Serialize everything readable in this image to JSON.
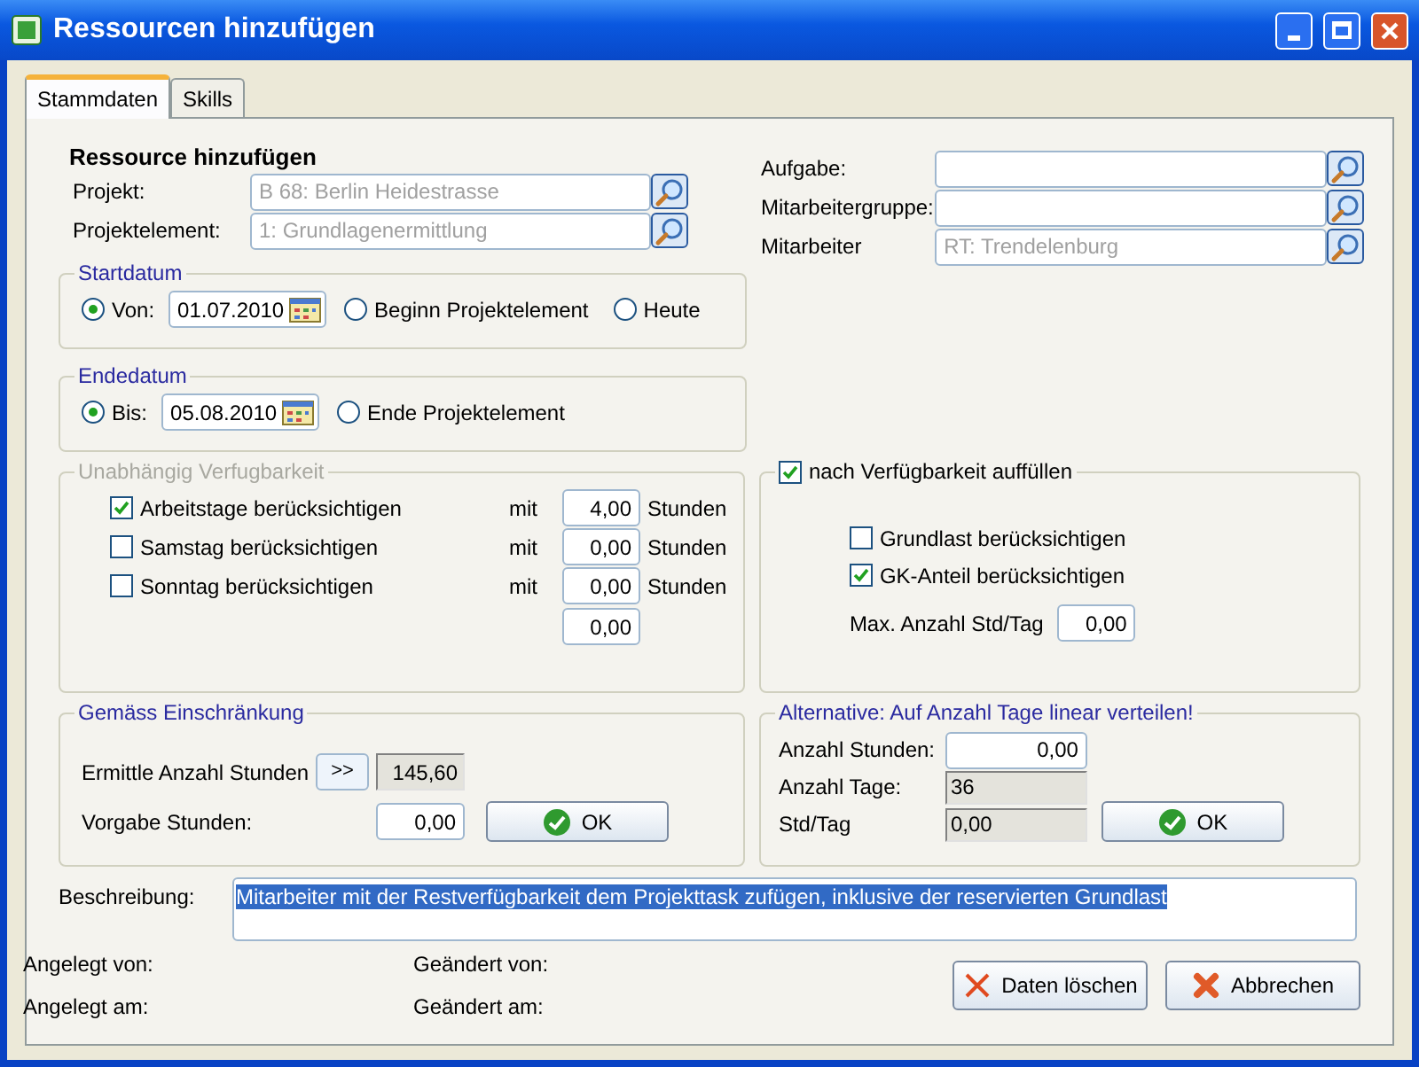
{
  "window": {
    "title": "Ressourcen hinzufügen"
  },
  "tabs": [
    {
      "label": "Stammdaten",
      "selected": true
    },
    {
      "label": "Skills",
      "selected": false
    }
  ],
  "heading": "Ressource hinzufügen",
  "left_fields": [
    {
      "label": "Projekt:",
      "value": "B 68: Berlin Heidestrasse",
      "disabled": true
    },
    {
      "label": "Projektelement:",
      "value": "1: Grundlagenermittlung",
      "disabled": true
    }
  ],
  "right_fields": [
    {
      "label": "Aufgabe:"
    },
    {
      "label": "Mitarbeitergruppe:"
    },
    {
      "label": "Mitarbeiter",
      "value": "RT: Trendelenburg",
      "disabled": true
    }
  ],
  "startdatum": {
    "title": "Startdatum",
    "options": [
      {
        "label": "Von:",
        "selected": true,
        "date": "01.07.2010"
      },
      {
        "label": "Beginn Projektelement",
        "selected": false
      },
      {
        "label": "Heute",
        "selected": false
      }
    ]
  },
  "endedatum": {
    "title": "Endedatum",
    "options": [
      {
        "label": "Bis:",
        "selected": true,
        "date": "05.08.2010"
      },
      {
        "label": "Ende Projektelement",
        "selected": false
      }
    ]
  },
  "unabhaengig": {
    "title": "Unabhängig Verfugbarkeit",
    "disabled": true,
    "rows": [
      {
        "label": "Arbeitstage berücksichtigen",
        "checked": true,
        "mit": "mit",
        "value": "4,00",
        "unit": "Stunden"
      },
      {
        "label": "Samstag berücksichtigen",
        "checked": false,
        "mit": "mit",
        "value": "0,00",
        "unit": "Stunden"
      },
      {
        "label": "Sonntag berücksichtigen",
        "checked": false,
        "mit": "mit",
        "value": "0,00",
        "unit": "Stunden"
      }
    ],
    "total": "0,00"
  },
  "auffuellen": {
    "label": "nach Verfügbarkeit auffüllen",
    "checked": true,
    "options": [
      {
        "label": "Grundlast berücksichtigen",
        "checked": false
      },
      {
        "label": "GK-Anteil berücksichtigen",
        "checked": true
      }
    ],
    "max_label": "Max. Anzahl Std/Tag",
    "max_value": "0,00"
  },
  "einschraenkung": {
    "title": "Gemäss Einschränkung",
    "ermittle_label": "Ermittle Anzahl Stunden",
    "ermittle_button": ">>",
    "ermittle_value": "145,60",
    "vorgabe_label": "Vorgabe Stunden:",
    "vorgabe_value": "0,00",
    "ok": "OK"
  },
  "alternative": {
    "title": "Alternative: Auf Anzahl Tage linear verteilen!",
    "rows": [
      {
        "label": "Anzahl Stunden:",
        "value": "0,00",
        "kind": "input"
      },
      {
        "label": "Anzahl Tage:",
        "value": "36",
        "kind": "readonly"
      },
      {
        "label": "Std/Tag",
        "value": "0,00",
        "kind": "readonly"
      }
    ],
    "ok": "OK"
  },
  "beschreibung": {
    "label": "Beschreibung:",
    "value": "Mitarbeiter mit der Restverfügbarkeit dem Projekttask zufügen, inklusive der reservierten Grundlast"
  },
  "meta": [
    {
      "label": "Angelegt von:"
    },
    {
      "label": "Geändert von:"
    },
    {
      "label": "Angelegt am:"
    },
    {
      "label": "Geändert am:"
    }
  ],
  "buttons": [
    {
      "label": "Daten löschen",
      "kind": "delete"
    },
    {
      "label": "Abbrechen",
      "kind": "cancel"
    }
  ]
}
